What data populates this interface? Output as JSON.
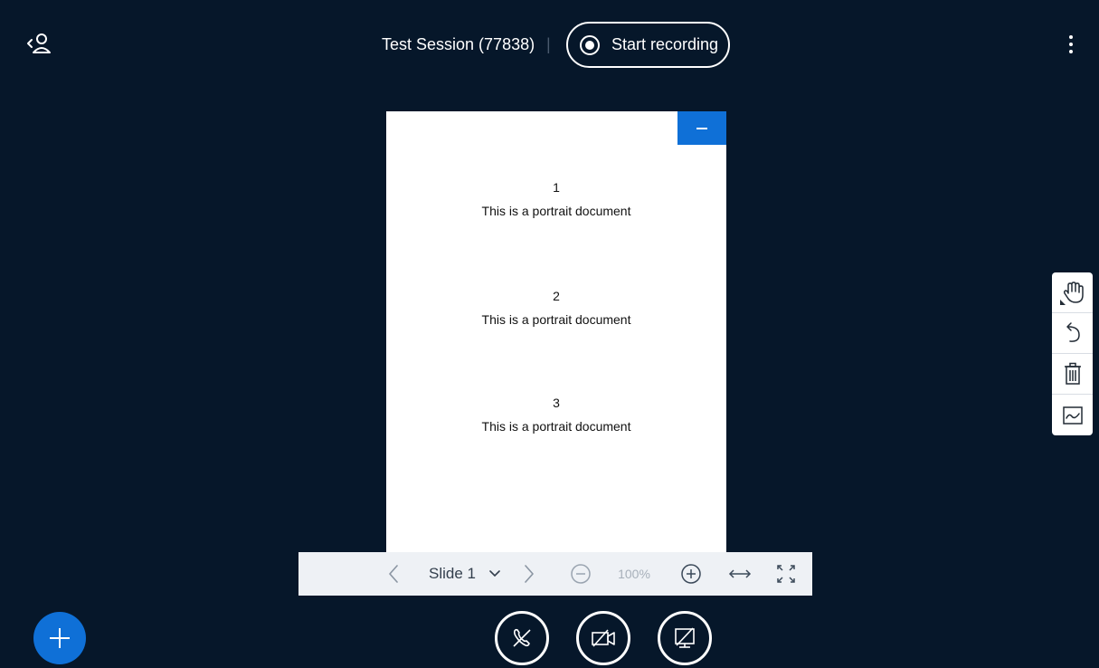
{
  "header": {
    "session_title": "Test Session (77838)",
    "separator": "|",
    "record_label": "Start recording"
  },
  "presentation": {
    "items": [
      {
        "number": "1",
        "text": "This is a portrait document"
      },
      {
        "number": "2",
        "text": "This is a portrait document"
      },
      {
        "number": "3",
        "text": "This is a portrait document"
      }
    ]
  },
  "toolbar": {
    "slide_label": "Slide 1",
    "zoom_label": "100%"
  },
  "icons": {
    "back": "users-back-icon",
    "record": "record-icon",
    "more": "more-vertical-icon",
    "minimize": "minimize-icon",
    "prev": "chevron-left-icon",
    "next": "chevron-right-icon",
    "dropdown": "chevron-down-icon",
    "zoom_out": "zoom-out-icon",
    "zoom_in": "zoom-in-icon",
    "fit_width": "fit-width-icon",
    "fullscreen": "fullscreen-icon",
    "hand": "hand-icon",
    "undo": "undo-icon",
    "clear": "trash-icon",
    "multiuser": "multi-user-whiteboard-icon",
    "plus": "plus-icon",
    "audio": "audio-off-icon",
    "video": "video-off-icon",
    "screenshare": "screenshare-off-icon"
  },
  "colors": {
    "background": "#06172a",
    "accent": "#0f70d7",
    "toolbar": "#eef1f5"
  }
}
